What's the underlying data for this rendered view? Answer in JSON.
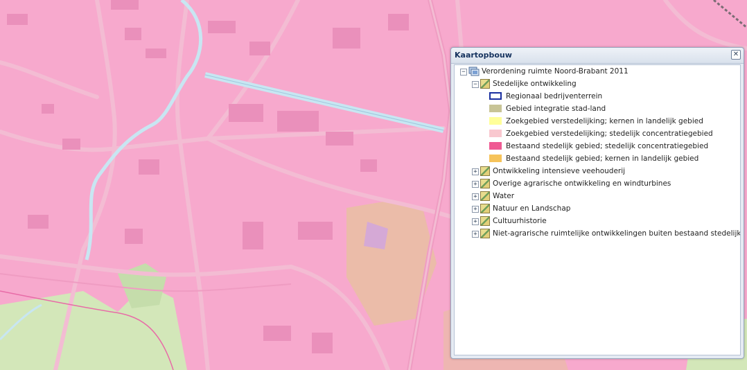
{
  "panel": {
    "title": "Kaartopbouw",
    "close_label": "✕"
  },
  "tree": {
    "root": {
      "label": "Verordening ruimte Noord-Brabant 2011",
      "toggle": "−"
    },
    "groups": [
      {
        "label": "Stedelijke ontwikkeling",
        "toggle": "−",
        "legend": [
          {
            "label": "Regionaal bedrijventerrein",
            "fill": "#ffffff",
            "border": "#1a2fa0"
          },
          {
            "label": "Gebied integratie stad-land",
            "fill": "#c8c496",
            "border": "#c8c496"
          },
          {
            "label": "Zoekgebied verstedelijking; kernen in landelijk gebied",
            "fill": "#ffff99",
            "border": "#ffff99"
          },
          {
            "label": "Zoekgebied verstedelijking; stedelijk concentratiegebied",
            "fill": "#f9c8cf",
            "border": "#f9c8cf"
          },
          {
            "label": "Bestaand stedelijk gebied; stedelijk concentratiegebied",
            "fill": "#ef5a93",
            "border": "#ef5a93"
          },
          {
            "label": "Bestaand stedelijk gebied; kernen in landelijk gebied",
            "fill": "#f6c35a",
            "border": "#f6c35a"
          }
        ]
      },
      {
        "label": "Ontwikkeling intensieve veehouderij",
        "toggle": "+"
      },
      {
        "label": "Overige agrarische ontwikkeling en windturbines",
        "toggle": "+"
      },
      {
        "label": "Water",
        "toggle": "+"
      },
      {
        "label": "Natuur en Landschap",
        "toggle": "+"
      },
      {
        "label": "Cultuurhistorie",
        "toggle": "+"
      },
      {
        "label": "Niet-agrarische ruimtelijke ontwikkelingen buiten bestaand stedelijk gebied",
        "toggle": "+"
      }
    ]
  },
  "colors": {
    "map_urban": "#f7a9cd",
    "map_road": "#f3bcd3",
    "map_building": "#ea90bb",
    "map_water": "#c8e6f2",
    "map_nature": "#d3e7b9",
    "map_rural": "#e7c0a0"
  }
}
